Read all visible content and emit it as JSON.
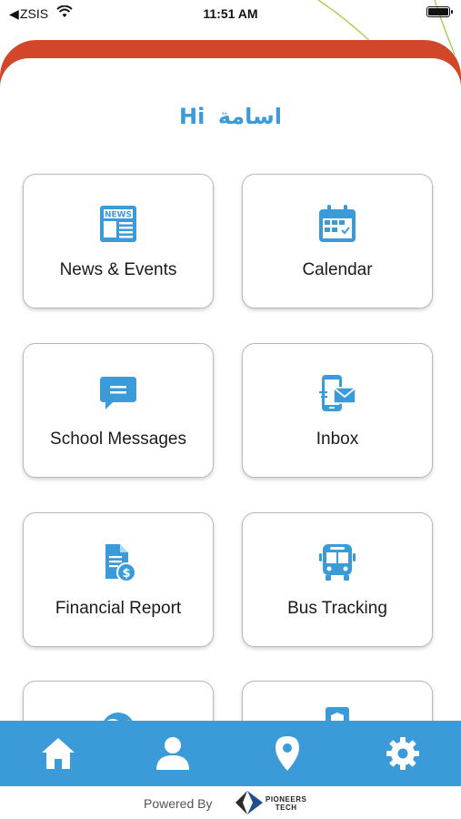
{
  "status_bar": {
    "back_glyph": "◀",
    "carrier": "ZSIS",
    "time": "11:51 AM"
  },
  "greeting": {
    "hi": "Hi",
    "name": "اسامة"
  },
  "menu": [
    {
      "label": "News & Events",
      "icon": "newspaper-icon",
      "badge": "NEWS"
    },
    {
      "label": "Calendar",
      "icon": "calendar-icon"
    },
    {
      "label": "School Messages",
      "icon": "chat-bubble-icon"
    },
    {
      "label": "Inbox",
      "icon": "phone-mail-icon"
    },
    {
      "label": "Financial Report",
      "icon": "document-dollar-icon"
    },
    {
      "label": "Bus Tracking",
      "icon": "bus-icon"
    }
  ],
  "bottom_nav": [
    {
      "icon": "home-icon"
    },
    {
      "icon": "user-icon"
    },
    {
      "icon": "location-pin-icon"
    },
    {
      "icon": "settings-icon"
    }
  ],
  "footer": {
    "powered_by": "Powered By",
    "brand_line1": "PIONEERS",
    "brand_line2": "TECH"
  },
  "colors": {
    "accent_blue": "#3a9bd8",
    "header_red": "#d2472a"
  }
}
